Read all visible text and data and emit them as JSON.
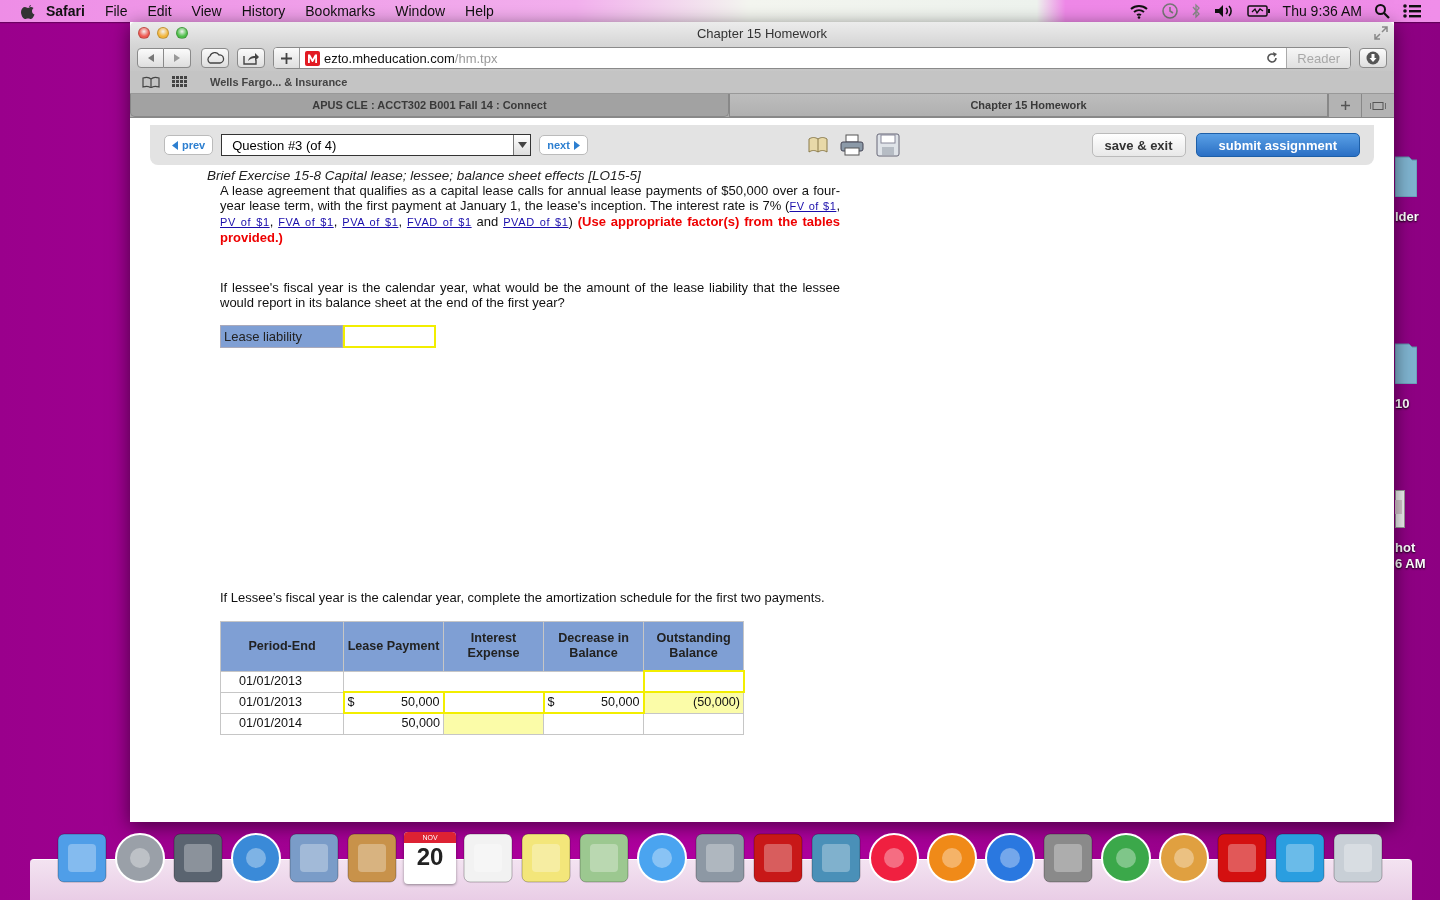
{
  "menubar": {
    "app": "Safari",
    "menus": [
      "File",
      "Edit",
      "View",
      "History",
      "Bookmarks",
      "Window",
      "Help"
    ],
    "clock": "Thu 9:36 AM"
  },
  "desktop_items": [
    {
      "kind": "folder",
      "lines": [
        "lder"
      ]
    },
    {
      "kind": "folder",
      "lines": [
        "10"
      ]
    },
    {
      "kind": "screenshot",
      "lines": [
        "hot",
        "6 AM"
      ]
    }
  ],
  "window": {
    "title": "Chapter 15 Homework",
    "address": {
      "host": "ezto.mheducation.com",
      "path": "/hm.tpx"
    },
    "reader": {
      "label": "Reader",
      "disabled": true
    },
    "bookmarks": [
      "Wells Fargo... & Insurance"
    ],
    "tabs": [
      {
        "label": "APUS CLE : ACCT302 B001 Fall 14 : Connect",
        "selected": false
      },
      {
        "label": "Chapter 15 Homework",
        "selected": true
      }
    ]
  },
  "question_bar": {
    "prev": "prev",
    "question": "Question #3 (of 4)",
    "next": "next",
    "save": "save & exit",
    "submit": "submit assignment"
  },
  "exercise": {
    "title": "Brief Exercise 15-8 Capital lease; lessee; balance sheet effects [LO15-5]",
    "intro": [
      {
        "kind": "text",
        "text": "A lease agreement that qualifies as a capital lease calls for annual lease payments of $50,000 over a four-year lease term, with the first payment at January 1, the lease's inception. The interest rate is 7% ("
      },
      {
        "kind": "link",
        "text": "FV of $1"
      },
      {
        "kind": "text",
        "text": ", "
      },
      {
        "kind": "link",
        "text": "PV of $1"
      },
      {
        "kind": "text",
        "text": ", "
      },
      {
        "kind": "link",
        "text": "FVA of $1"
      },
      {
        "kind": "text",
        "text": ", "
      },
      {
        "kind": "link",
        "text": "PVA of $1"
      },
      {
        "kind": "text",
        "text": ", "
      },
      {
        "kind": "link",
        "text": "FVAD of $1"
      },
      {
        "kind": "text",
        "text": " and "
      },
      {
        "kind": "link",
        "text": "PVAD of $1"
      },
      {
        "kind": "text",
        "text": ") "
      },
      {
        "kind": "emphasis",
        "text": "(Use appropriate factor(s) from the tables provided.)"
      }
    ],
    "question_1": "If lessee's fiscal year is the calendar year, what would be the amount of the lease liability that the lessee would report in its balance sheet at the end of the first year?",
    "answer": {
      "label": "Lease liability"
    },
    "question_2": "If Lessee’s fiscal year is the calendar year, complete the amortization schedule for the first two payments.",
    "table": {
      "columns": [
        "Period-End",
        "Lease Payment",
        "Interest Expense",
        "Decrease in Balance",
        "Outstanding Balance"
      ],
      "rows": [
        {
          "cells": [
            {
              "kind": "text",
              "value": "01/01/2013"
            },
            {
              "kind": "merged"
            },
            {
              "kind": "input"
            }
          ]
        },
        {
          "cells": [
            {
              "kind": "text",
              "value": "01/01/2013"
            },
            {
              "kind": "input",
              "currency": "$",
              "value": "50,000"
            },
            {
              "kind": "input"
            },
            {
              "kind": "input",
              "currency": "$",
              "value": "50,000"
            },
            {
              "kind": "filled",
              "value": "(50,000)"
            }
          ]
        },
        {
          "cells": [
            {
              "kind": "text",
              "value": "01/01/2014"
            },
            {
              "kind": "text",
              "value": "50,000"
            },
            {
              "kind": "filled"
            },
            {
              "kind": "text"
            },
            {
              "kind": "text"
            }
          ]
        }
      ]
    }
  },
  "dock": {
    "calendar_month": "NOV",
    "calendar_day": "20"
  }
}
